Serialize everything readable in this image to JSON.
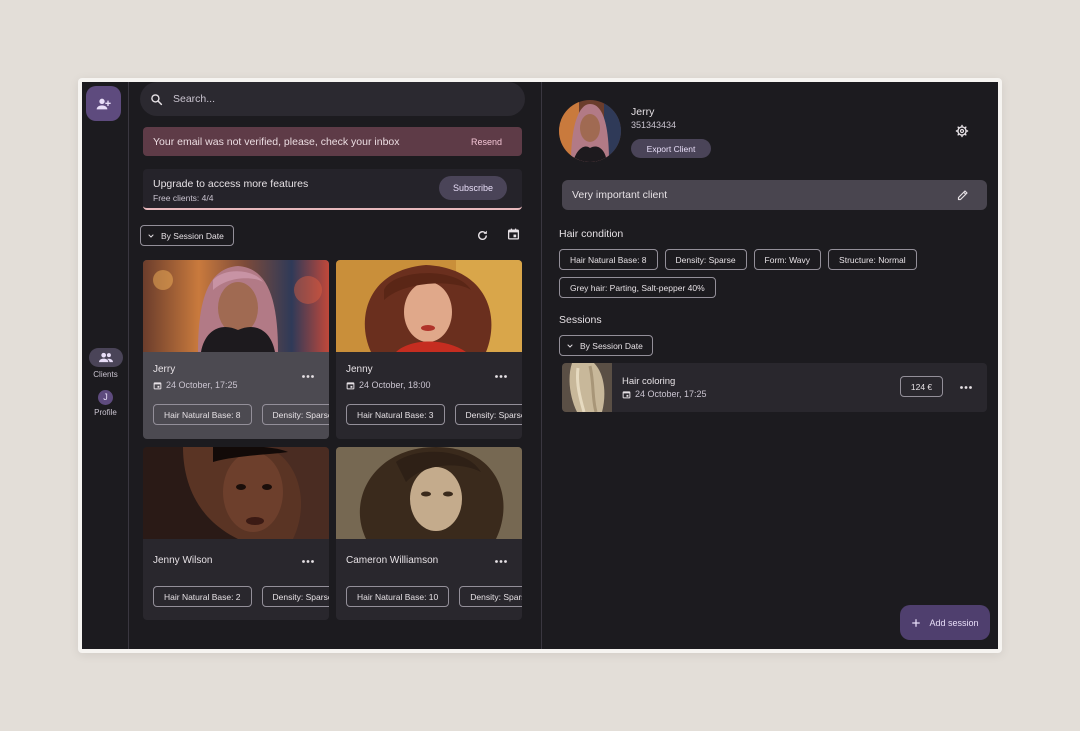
{
  "search": {
    "placeholder": "Search..."
  },
  "nav": {
    "clients_label": "Clients",
    "profile_label": "Profile",
    "profile_initial": "J"
  },
  "alert": {
    "text": "Your email was not verified, please, check your inbox",
    "action": "Resend"
  },
  "upgrade": {
    "title": "Upgrade to access more features",
    "subtitle": "Free clients: 4/4",
    "button": "Subscribe"
  },
  "list_sort": {
    "label": "By Session Date"
  },
  "clients": [
    {
      "name": "Jerry",
      "date": "24 October, 17:25",
      "chips": [
        "Hair Natural Base: 8",
        "Density: Sparse"
      ]
    },
    {
      "name": "Jenny",
      "date": "24 October, 18:00",
      "chips": [
        "Hair Natural Base: 3",
        "Density: Sparse"
      ]
    },
    {
      "name": "Jenny Wilson",
      "chips": [
        "Hair Natural Base: 2",
        "Density: Sparse"
      ]
    },
    {
      "name": "Cameron Williamson",
      "chips": [
        "Hair Natural Base: 10",
        "Density: Sparse"
      ]
    }
  ],
  "detail": {
    "name": "Jerry",
    "phone": "351343434",
    "export_button": "Export Client",
    "note": "Very important client",
    "hair_condition_title": "Hair condition",
    "hair_chips": [
      "Hair Natural Base: 8",
      "Density: Sparse",
      "Form: Wavy",
      "Structure: Normal",
      "Grey hair: Parting, Salt-pepper 40%"
    ],
    "sessions_title": "Sessions",
    "sessions_sort": "By Session Date",
    "session": {
      "title": "Hair coloring",
      "date": "24 October, 17:25",
      "price": "124 €"
    },
    "add_session": "Add session"
  },
  "colors": {
    "surface": "#1c1b1f",
    "card": "#29272d",
    "card_selected": "#4c4a51",
    "alert": "#5e3b47",
    "accent": "#5e4b7e",
    "progress": "#e8b9bd"
  },
  "upgrade_progress": 1.0
}
